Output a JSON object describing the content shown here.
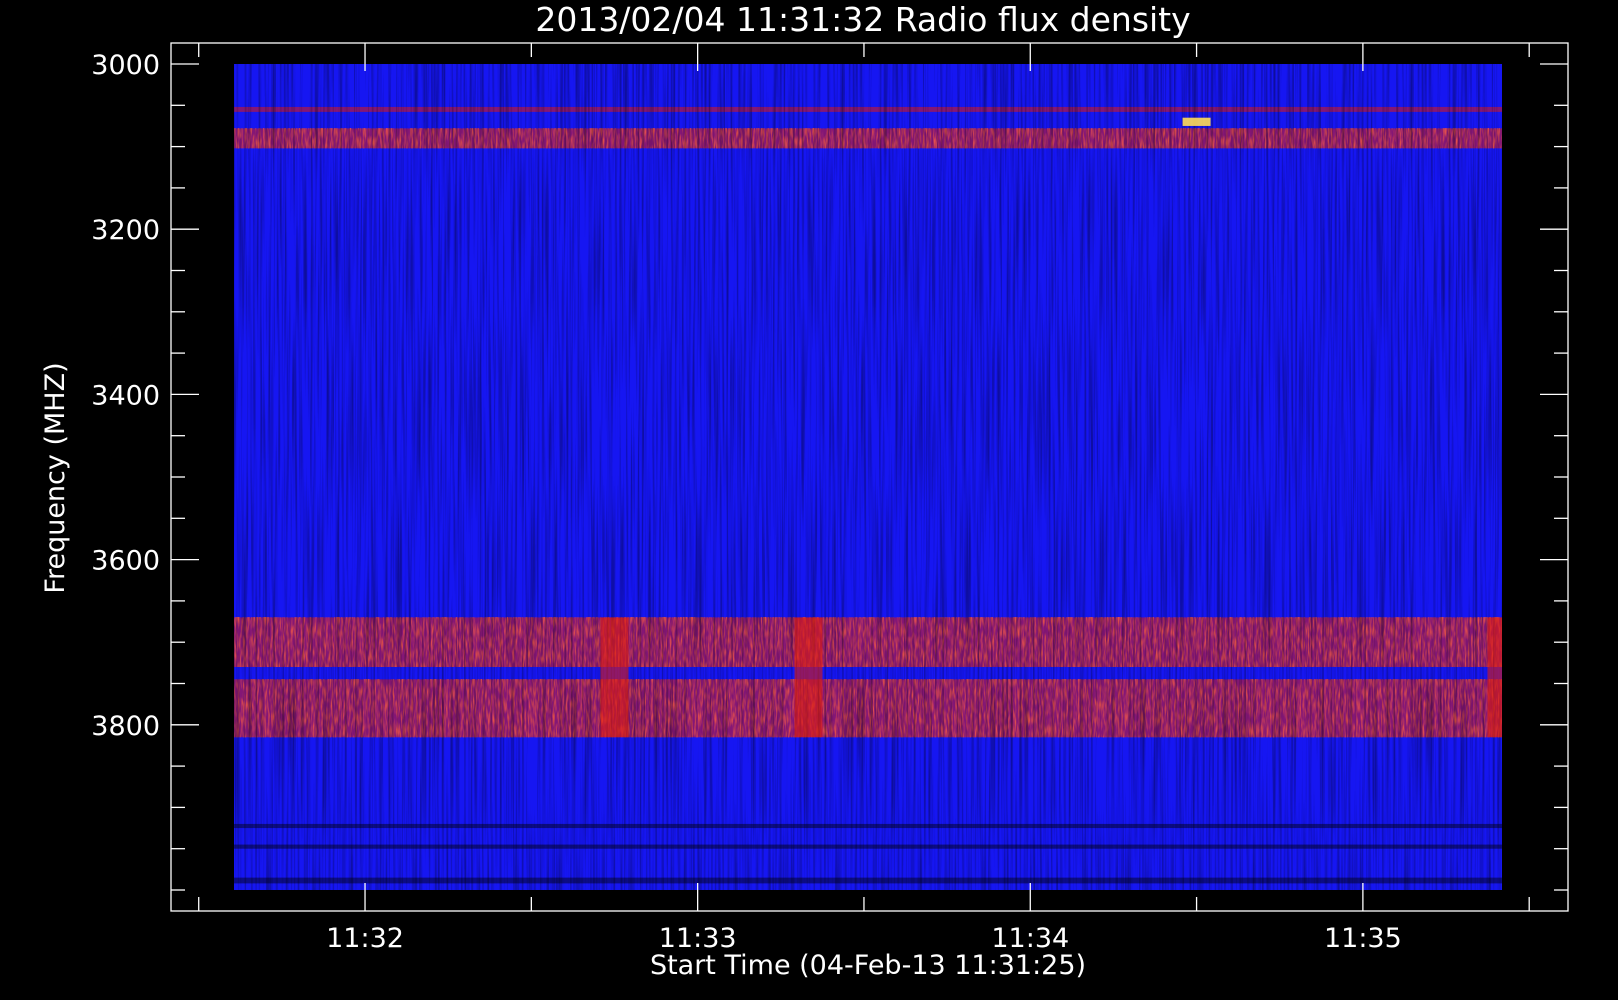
{
  "chart_data": {
    "type": "heatmap",
    "title": "2013/02/04 11:31:32 Radio flux density",
    "xlabel": "Start Time (04-Feb-13 11:31:25)",
    "ylabel": "Frequency (MHZ)",
    "xlim": [
      "11:31:25",
      "11:35:37"
    ],
    "ylim": [
      4000,
      3000
    ],
    "x_data_range": [
      "11:31:32",
      "11:35:28"
    ],
    "y_data_range": [
      3000,
      4000
    ],
    "x_ticks": [
      "11:32",
      "11:33",
      "11:34",
      "11:35"
    ],
    "y_ticks": [
      3000,
      3200,
      3400,
      3600,
      3800
    ],
    "colors": {
      "background_band": "#1414f0",
      "quiet": "#1a1aff",
      "enhanced": "#e01a10",
      "strong": "#ffdd55",
      "dropout": "#000000"
    },
    "bands": [
      {
        "from": 3052,
        "to": 3058,
        "level": "moderate"
      },
      {
        "from": 3078,
        "to": 3102,
        "level": "high"
      },
      {
        "from": 3670,
        "to": 3730,
        "level": "high"
      },
      {
        "from": 3745,
        "to": 3815,
        "level": "high"
      },
      {
        "from": 3920,
        "to": 3925,
        "level": "low"
      },
      {
        "from": 3945,
        "to": 3950,
        "level": "low"
      },
      {
        "from": 3985,
        "to": 3992,
        "level": "low"
      }
    ],
    "bursts": [
      {
        "time": "11:33:20",
        "freq": [
          3670,
          3815
        ],
        "level": "high"
      },
      {
        "time": "11:32:45",
        "freq": [
          3670,
          3815
        ],
        "level": "high"
      },
      {
        "time": "11:34:30",
        "freq": [
          3065,
          3075
        ],
        "level": "very-high"
      },
      {
        "time": "11:35:25",
        "freq": [
          3670,
          3815
        ],
        "level": "high"
      }
    ],
    "grid": false,
    "legend": "none"
  }
}
